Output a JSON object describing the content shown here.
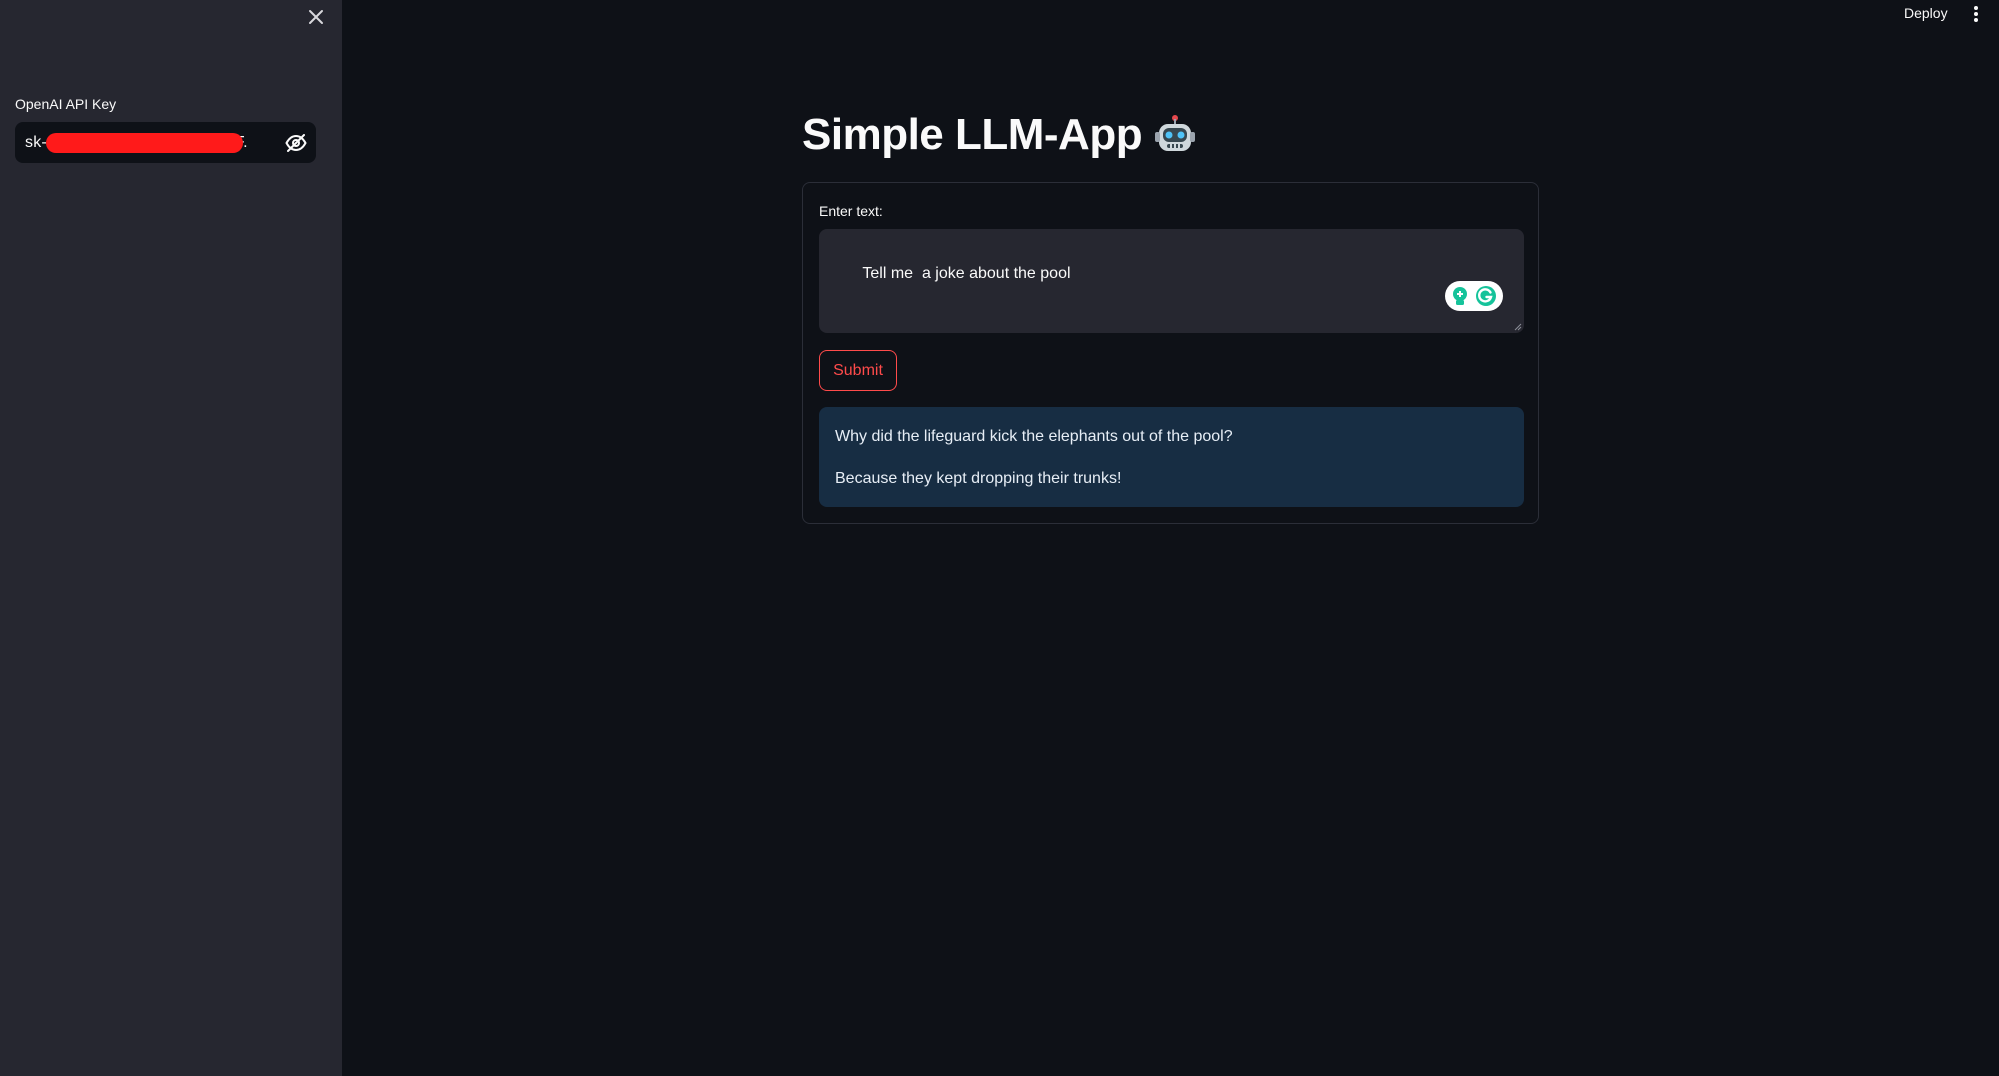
{
  "sidebar": {
    "api_key_label": "OpenAI API Key",
    "api_key_visible_prefix": "sk-",
    "api_key_visible_suffix": "!bkF.",
    "redaction_color": "#ff1a1a"
  },
  "header": {
    "deploy_label": "Deploy"
  },
  "main": {
    "title": "Simple LLM-App",
    "title_emoji": "robot-face",
    "form": {
      "field_label": "Enter text:",
      "textarea_value": "Tell me  a joke about the pool",
      "submit_label": "Submit",
      "response_lines": [
        "Why did the lifeguard kick the elephants out of the pool?",
        "Because they kept dropping their trunks!"
      ]
    }
  },
  "colors": {
    "background": "#0e1117",
    "sidebar": "#262730",
    "accent": "#ff4b4b",
    "info_box": "#172d43"
  },
  "icons": {
    "close": "close-icon",
    "visibility": "eye-off-icon",
    "menu": "kebab-menu-icon",
    "grammarly": "grammarly-icon"
  }
}
